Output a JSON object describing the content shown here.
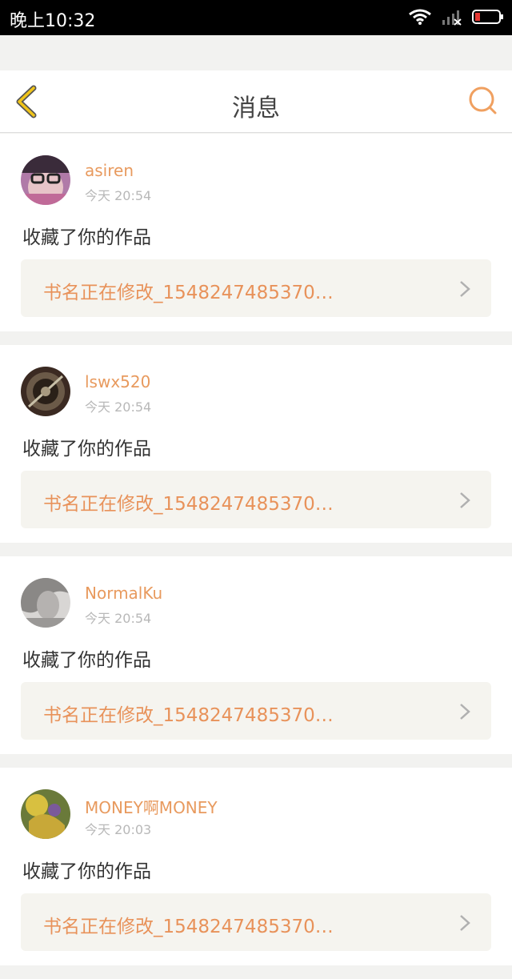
{
  "status_bar": {
    "time": "晚上10:32"
  },
  "header": {
    "title": "消息",
    "back_icon": "chevron-left-icon",
    "search_icon": "search-icon"
  },
  "colors": {
    "accent": "#e8925a",
    "username": "#e89a5e",
    "back_icon": "#e6b800"
  },
  "messages": [
    {
      "username": "asiren",
      "time": "今天 20:54",
      "action": "收藏了你的作品",
      "work_title": "书名正在修改_1548247485370…"
    },
    {
      "username": "lswx520",
      "time": "今天 20:54",
      "action": "收藏了你的作品",
      "work_title": "书名正在修改_1548247485370…"
    },
    {
      "username": "NormalKu",
      "time": "今天 20:54",
      "action": "收藏了你的作品",
      "work_title": "书名正在修改_1548247485370…"
    },
    {
      "username": "MONEY啊MONEY",
      "time": "今天 20:03",
      "action": "收藏了你的作品",
      "work_title": "书名正在修改_1548247485370…"
    }
  ]
}
